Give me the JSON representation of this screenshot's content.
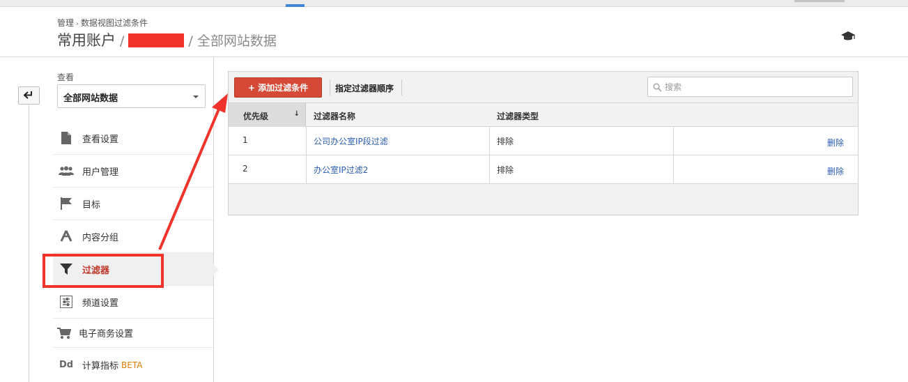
{
  "breadcrumb": {
    "root": "管理",
    "current": "数据视图过滤条件"
  },
  "title": {
    "account": "常用账户",
    "property_redacted": "",
    "view": "全部网站数据"
  },
  "sidebar": {
    "view_label": "查看",
    "view_select": "全部网站数据",
    "items": [
      {
        "label": "查看设置",
        "icon": "document-icon"
      },
      {
        "label": "用户管理",
        "icon": "users-icon"
      },
      {
        "label": "目标",
        "icon": "flag-icon"
      },
      {
        "label": "内容分组",
        "icon": "content-grouping-icon"
      },
      {
        "label": "过滤器",
        "icon": "filter-icon",
        "active": true
      },
      {
        "label": "频道设置",
        "icon": "channel-settings-icon"
      },
      {
        "label": "电子商务设置",
        "icon": "cart-icon"
      },
      {
        "label": "计算指标",
        "icon": "dd-icon",
        "badge": "BETA"
      }
    ]
  },
  "toolbar": {
    "add_label": "+ 添加过滤条件",
    "order_label": "指定过滤器顺序",
    "search_placeholder": "搜索"
  },
  "table": {
    "headers": {
      "priority": "优先级",
      "sort": "↓",
      "name": "过滤器名称",
      "type": "过滤器类型"
    },
    "rows": [
      {
        "priority": "1",
        "name": "公司办公室IP段过滤",
        "type": "排除",
        "action": "删除"
      },
      {
        "priority": "2",
        "name": "办公室IP过滤2",
        "type": "排除",
        "action": "删除"
      }
    ]
  },
  "colors": {
    "accent": "#d64937",
    "link": "#2a5db0",
    "annotation": "#f0332b",
    "active_text": "#c0392b"
  }
}
